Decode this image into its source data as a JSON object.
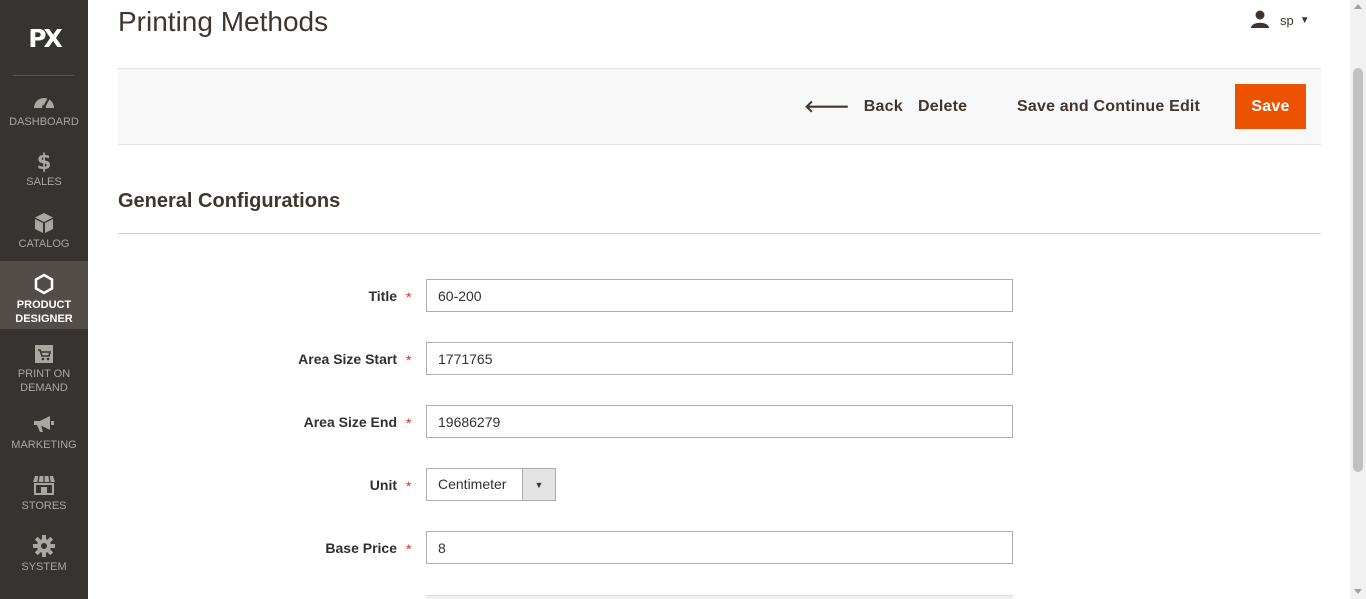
{
  "brand": {
    "logo": "PX"
  },
  "sidebar": {
    "items": [
      {
        "id": "dashboard",
        "label": "DASHBOARD",
        "icon": "gauge-icon"
      },
      {
        "id": "sales",
        "label": "SALES",
        "icon": "dollar-icon"
      },
      {
        "id": "catalog",
        "label": "CATALOG",
        "icon": "box-icon"
      },
      {
        "id": "product-designer",
        "label": "PRODUCT DESIGNER",
        "line1": "PRODUCT",
        "line2": "DESIGNER",
        "icon": "hexagon-icon",
        "active": true
      },
      {
        "id": "print-on-demand",
        "label": "PRINT ON DEMAND",
        "line1": "PRINT ON",
        "line2": "DEMAND",
        "icon": "cart-icon"
      },
      {
        "id": "marketing",
        "label": "MARKETING",
        "icon": "megaphone-icon"
      },
      {
        "id": "stores",
        "label": "STORES",
        "icon": "store-icon"
      },
      {
        "id": "system",
        "label": "SYSTEM",
        "icon": "gear-icon"
      }
    ]
  },
  "header": {
    "title": "Printing Methods",
    "user": "sp"
  },
  "actions": {
    "back": "Back",
    "delete": "Delete",
    "save_continue": "Save and Continue Edit",
    "save": "Save"
  },
  "section": {
    "title": "General Configurations"
  },
  "form": {
    "title": {
      "label": "Title",
      "value": "60-200"
    },
    "area_start": {
      "label": "Area Size Start",
      "value": "1771765"
    },
    "area_end": {
      "label": "Area Size End",
      "value": "19686279"
    },
    "unit": {
      "label": "Unit",
      "value": "Centimeter"
    },
    "base_price": {
      "label": "Base Price",
      "value": "8"
    },
    "required_marker": "*"
  },
  "colors": {
    "sidebar_bg": "#373330",
    "sidebar_active": "#524d49",
    "accent": "#eb5202",
    "required": "#e22626"
  }
}
